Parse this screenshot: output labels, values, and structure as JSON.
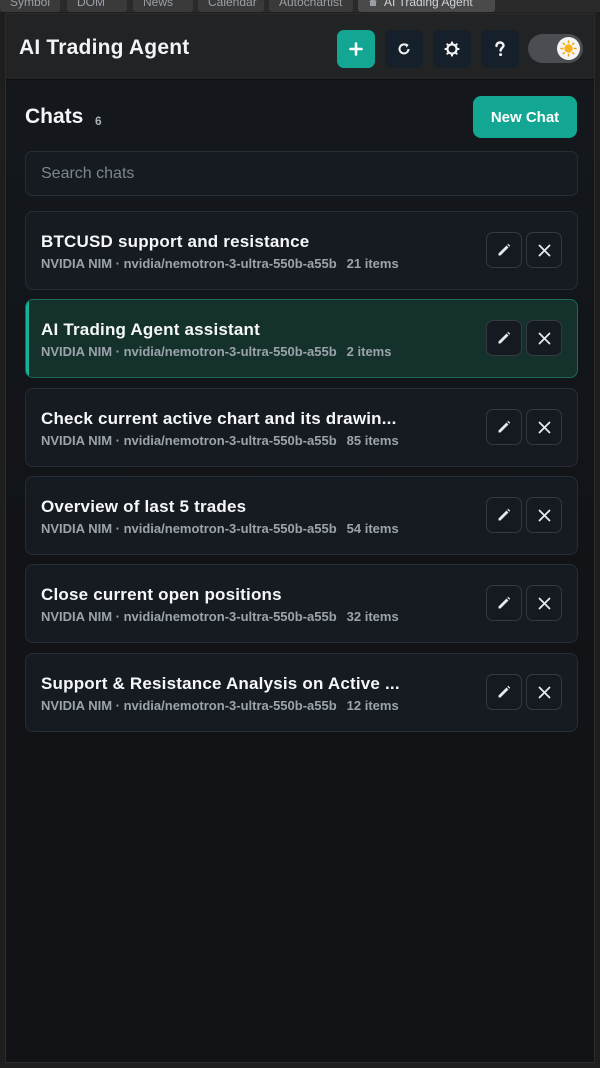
{
  "tabs": [
    {
      "label": "Symbol"
    },
    {
      "label": "DOM"
    },
    {
      "label": "News"
    },
    {
      "label": "Calendar"
    },
    {
      "label": "Autochartist"
    },
    {
      "label": "AI Trading Agent"
    }
  ],
  "header": {
    "title": "AI Trading Agent",
    "icons": [
      "plus-icon",
      "refresh-icon",
      "gear-icon",
      "help-icon",
      "sun-icon"
    ],
    "accent": "#12a693"
  },
  "chats": {
    "heading": "Chats",
    "count": "6",
    "new_chat_label": "New Chat",
    "search_placeholder": "Search chats",
    "items": [
      {
        "title": "BTCUSD support and resistance",
        "meta": "NVIDIA NIM · nvidia/nemotron-3-ultra-550b-a55b",
        "count": "21 items",
        "active": false
      },
      {
        "title": "AI Trading Agent assistant",
        "meta": "NVIDIA NIM · nvidia/nemotron-3-ultra-550b-a55b",
        "count": "2 items",
        "active": true
      },
      {
        "title": "Check current active chart and its drawin...",
        "meta": "NVIDIA NIM · nvidia/nemotron-3-ultra-550b-a55b",
        "count": "85 items",
        "active": false
      },
      {
        "title": "Overview of last 5 trades",
        "meta": "NVIDIA NIM · nvidia/nemotron-3-ultra-550b-a55b",
        "count": "54 items",
        "active": false
      },
      {
        "title": "Close current open positions",
        "meta": "NVIDIA NIM · nvidia/nemotron-3-ultra-550b-a55b",
        "count": "32 items",
        "active": false
      },
      {
        "title": "Support & Resistance Analysis on Active ...",
        "meta": "NVIDIA NIM · nvidia/nemotron-3-ultra-550b-a55b",
        "count": "12 items",
        "active": false
      }
    ],
    "item_icons": [
      "pencil-icon",
      "close-icon"
    ]
  }
}
